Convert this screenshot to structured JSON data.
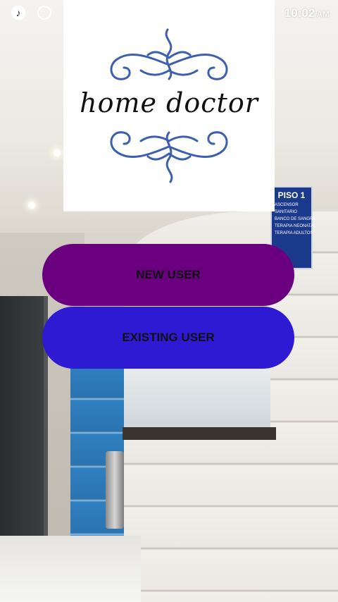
{
  "status_bar": {
    "time": "10:02",
    "ampm": "AM",
    "icons": [
      "music-note-icon",
      "more-dots-icon"
    ]
  },
  "logo": {
    "text": "home doctor",
    "ornament_color": "#3d5fae"
  },
  "background": {
    "sign_title": "PISO 1",
    "sign_lines": [
      "ASCENSOR",
      "SANITARIO",
      "BANCO DE SANGRE",
      "TERAPIA NEONATAL",
      "TERAPIA ADULTOS"
    ]
  },
  "buttons": {
    "new_user": {
      "label": "NEW USER",
      "color": "#6a0080"
    },
    "existing_user": {
      "label": "EXISTING USER",
      "color": "#2f1ad4"
    }
  }
}
